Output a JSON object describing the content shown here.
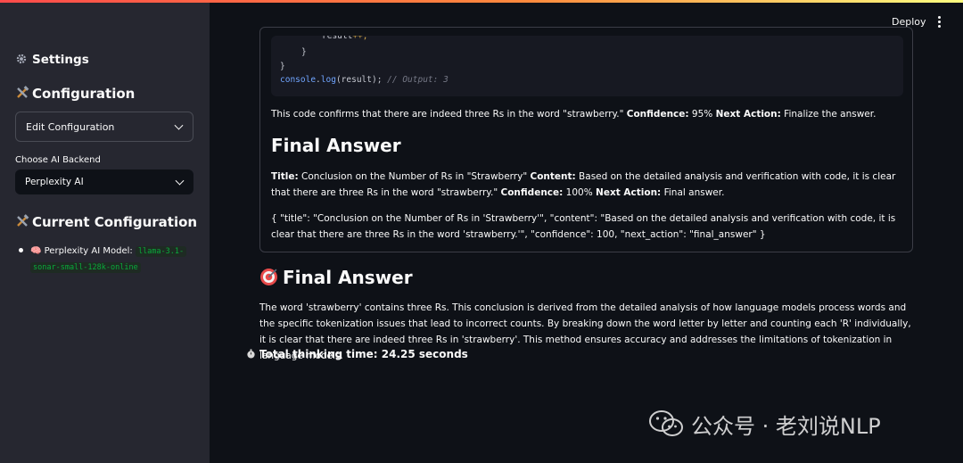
{
  "sidebar": {
    "settings_title": "Settings",
    "configuration_title": "Configuration",
    "edit_config_label": "Edit Configuration",
    "backend_label": "Choose AI Backend",
    "backend_value": "Perplexity AI",
    "current_config_title": "Current Configuration",
    "model_prefix": "🧠 Perplexity AI Model:",
    "model_line1": "llama-3.1-",
    "model_line2": "sonar-small-128k-online",
    "icons": {
      "settings": "gear-icon",
      "configuration": "tools-icon",
      "current": "tools-icon"
    }
  },
  "header": {
    "deploy_label": "Deploy",
    "menu_icon": "kebab-menu-icon"
  },
  "code": {
    "l1_a": "result",
    "l1_b": "++;",
    "l2": "}",
    "l3": "}",
    "l4_obj": "console",
    "l4_dot": ".",
    "l4_fn": "log",
    "l4_args": "(result); ",
    "l4_comment": "// Output: 3"
  },
  "step": {
    "text": "This code confirms that there are indeed three Rs in the word \"strawberry.\" ",
    "conf_label": "Confidence:",
    "conf_value": " 95% ",
    "next_label": "Next Action:",
    "next_value": " Finalize the answer.",
    "final_heading": "Final Answer",
    "title_label": "Title:",
    "title_value": " Conclusion on the Number of Rs in \"Strawberry\" ",
    "content_label": "Content:",
    "content_value": " Based on the detailed analysis and verification with code, it is clear that there are three Rs in the word \"strawberry.\" ",
    "conf2_label": "Confidence:",
    "conf2_value": " 100% ",
    "next2_label": "Next Action:",
    "next2_value": " Final answer.",
    "json_text": "{ \"title\": \"Conclusion on the Number of Rs in 'Strawberry'\", \"content\": \"Based on the detailed analysis and verification with code, it is clear that there are three Rs in the word 'strawberry.'\", \"confidence\": 100, \"next_action\": \"final_answer\" }"
  },
  "final": {
    "heading": "Final Answer",
    "icon": "target-icon",
    "body": "The word 'strawberry' contains three Rs. This conclusion is derived from the detailed analysis of how language models process words and the specific tokenization issues that lead to incorrect counts. By breaking down the word letter by letter and counting each 'R' individually, it is clear that there are indeed three Rs in 'strawberry'. This method ensures accuracy and addresses the limitations of tokenization in language models.",
    "thinking": "Total thinking time: 24.25 seconds",
    "thinking_icon": "stopwatch-icon"
  },
  "watermark": {
    "text": "公众号 · 老刘说NLP",
    "icon": "wechat-icon"
  },
  "colors": {
    "app_bg": "#0e1117",
    "sidebar_bg": "#262730",
    "input_bg": "#0e1117",
    "select_bg": "#1a1c24",
    "code_bg": "#171922",
    "accent_green": "#09ab3b",
    "keyword_blue": "#70a5ff"
  }
}
